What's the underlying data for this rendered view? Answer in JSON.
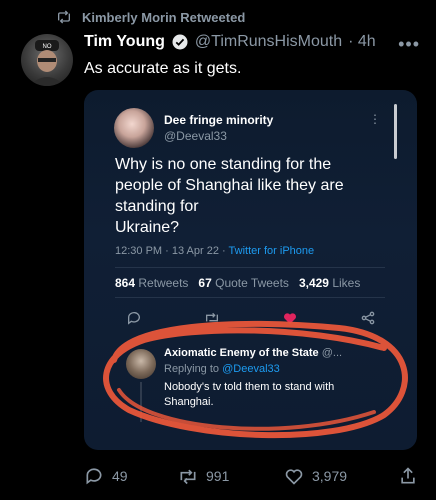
{
  "retweet": {
    "label": "Kimberly Morin Retweeted"
  },
  "tweet": {
    "name": "Tim Young",
    "handle": "@TimRunsHisMouth",
    "time": "· 4h",
    "text": "As accurate as it gets.",
    "more": "•••",
    "avatar_badge": "NO"
  },
  "quoted": {
    "name": "Dee fringe minority",
    "handle": "@Deeval33",
    "more": "⋮",
    "text_lines": [
      "Why is no one standing for the",
      "people of Shanghai like they are",
      "standing for",
      "Ukraine?"
    ],
    "time": "12:30 PM · 13 Apr 22 ·",
    "source": "Twitter for iPhone",
    "stats": {
      "retweets_count": "864",
      "retweets_label": "Retweets",
      "quotes_count": "67",
      "quotes_label": "Quote Tweets",
      "likes_count": "3,429",
      "likes_label": "Likes"
    },
    "reply": {
      "name": "Axiomatic Enemy of the State",
      "handle": "@...",
      "replying_prefix": "Replying to",
      "replying_to": "@Deeval33",
      "text_lines": [
        "Nobody's tv told them to stand with",
        "Shanghai."
      ]
    }
  },
  "footer": {
    "replies": "49",
    "retweets": "991",
    "likes": "3,979"
  },
  "colors": {
    "background": "#000000",
    "accent": "#1d9bf0",
    "annotation": "#e8563a",
    "muted": "#8b98a5"
  },
  "icons": [
    "retweet-icon",
    "verified-badge-icon",
    "more-icon",
    "reply-icon",
    "like-icon",
    "share-icon"
  ]
}
